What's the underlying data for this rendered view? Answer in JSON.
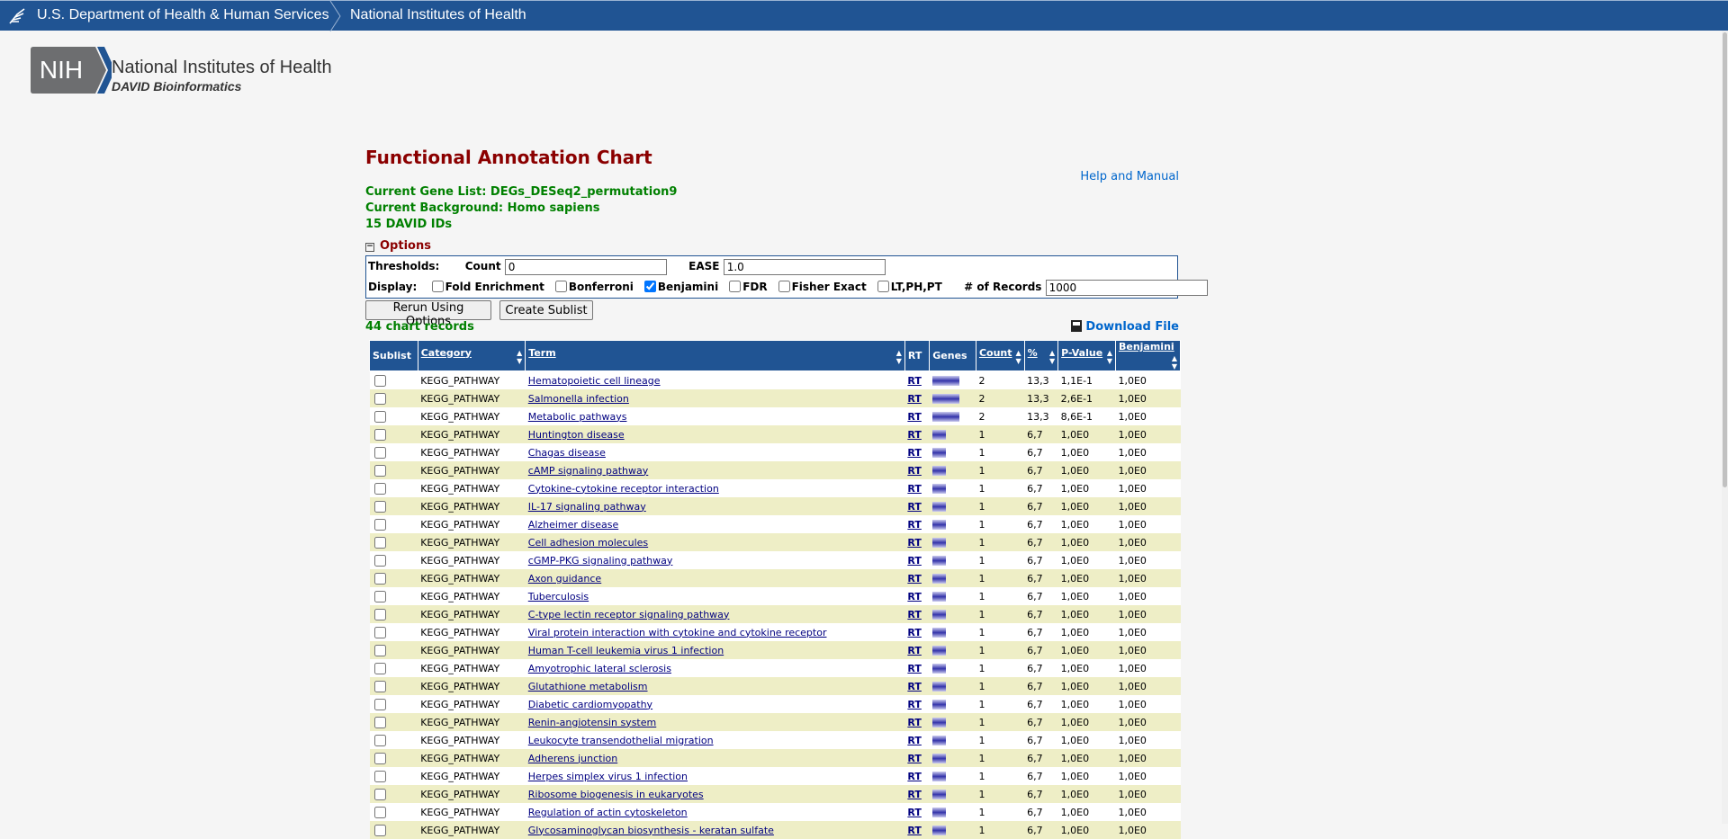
{
  "hhs": {
    "department": "U.S. Department of Health & Human Services",
    "institute": "National Institutes of Health"
  },
  "logo": {
    "badge": "NIH",
    "title": "National Institutes of Health",
    "subtitle": "DAVID Bioinformatics"
  },
  "page": {
    "title": "Functional Annotation Chart",
    "help": "Help and Manual",
    "gene_list": "Current Gene List: DEGs_DESeq2_permutation9",
    "background": "Current Background: Homo sapiens",
    "ids": "15 DAVID IDs"
  },
  "options": {
    "toggle_label": "Options",
    "thresholds_label": "Thresholds:",
    "count_label": "Count",
    "count_value": "0",
    "ease_label": "EASE",
    "ease_value": "1.0",
    "display_label": "Display:",
    "checkboxes": [
      {
        "label": "Fold Enrichment",
        "checked": false
      },
      {
        "label": "Bonferroni",
        "checked": false
      },
      {
        "label": "Benjamini",
        "checked": true
      },
      {
        "label": "FDR",
        "checked": false
      },
      {
        "label": "Fisher Exact",
        "checked": false
      },
      {
        "label": "LT,PH,PT",
        "checked": false
      }
    ],
    "records_label": "# of Records",
    "records_value": "1000"
  },
  "buttons": {
    "rerun": "Rerun Using Options",
    "sublist": "Create Sublist"
  },
  "record_count": "44 chart records",
  "download": "Download File",
  "table": {
    "headers": [
      "Sublist",
      "Category",
      "Term",
      "RT",
      "Genes",
      "Count",
      "%",
      "P-Value",
      "Benjamini"
    ],
    "rows": [
      {
        "category": "KEGG_PATHWAY",
        "term": "Hematopoietic cell lineage",
        "rt": "RT",
        "count": "2",
        "pct": "13,3",
        "p": "1,1E-1",
        "b": "1,0E0"
      },
      {
        "category": "KEGG_PATHWAY",
        "term": "Salmonella infection",
        "rt": "RT",
        "count": "2",
        "pct": "13,3",
        "p": "2,6E-1",
        "b": "1,0E0"
      },
      {
        "category": "KEGG_PATHWAY",
        "term": "Metabolic pathways",
        "rt": "RT",
        "count": "2",
        "pct": "13,3",
        "p": "8,6E-1",
        "b": "1,0E0"
      },
      {
        "category": "KEGG_PATHWAY",
        "term": "Huntington disease",
        "rt": "RT",
        "count": "1",
        "pct": "6,7",
        "p": "1,0E0",
        "b": "1,0E0"
      },
      {
        "category": "KEGG_PATHWAY",
        "term": "Chagas disease",
        "rt": "RT",
        "count": "1",
        "pct": "6,7",
        "p": "1,0E0",
        "b": "1,0E0"
      },
      {
        "category": "KEGG_PATHWAY",
        "term": "cAMP signaling pathway",
        "rt": "RT",
        "count": "1",
        "pct": "6,7",
        "p": "1,0E0",
        "b": "1,0E0"
      },
      {
        "category": "KEGG_PATHWAY",
        "term": "Cytokine-cytokine receptor interaction",
        "rt": "RT",
        "count": "1",
        "pct": "6,7",
        "p": "1,0E0",
        "b": "1,0E0"
      },
      {
        "category": "KEGG_PATHWAY",
        "term": "IL-17 signaling pathway",
        "rt": "RT",
        "count": "1",
        "pct": "6,7",
        "p": "1,0E0",
        "b": "1,0E0"
      },
      {
        "category": "KEGG_PATHWAY",
        "term": "Alzheimer disease",
        "rt": "RT",
        "count": "1",
        "pct": "6,7",
        "p": "1,0E0",
        "b": "1,0E0"
      },
      {
        "category": "KEGG_PATHWAY",
        "term": "Cell adhesion molecules",
        "rt": "RT",
        "count": "1",
        "pct": "6,7",
        "p": "1,0E0",
        "b": "1,0E0"
      },
      {
        "category": "KEGG_PATHWAY",
        "term": "cGMP-PKG signaling pathway",
        "rt": "RT",
        "count": "1",
        "pct": "6,7",
        "p": "1,0E0",
        "b": "1,0E0"
      },
      {
        "category": "KEGG_PATHWAY",
        "term": "Axon guidance",
        "rt": "RT",
        "count": "1",
        "pct": "6,7",
        "p": "1,0E0",
        "b": "1,0E0"
      },
      {
        "category": "KEGG_PATHWAY",
        "term": "Tuberculosis",
        "rt": "RT",
        "count": "1",
        "pct": "6,7",
        "p": "1,0E0",
        "b": "1,0E0"
      },
      {
        "category": "KEGG_PATHWAY",
        "term": "C-type lectin receptor signaling pathway",
        "rt": "RT",
        "count": "1",
        "pct": "6,7",
        "p": "1,0E0",
        "b": "1,0E0"
      },
      {
        "category": "KEGG_PATHWAY",
        "term": "Viral protein interaction with cytokine and cytokine receptor",
        "rt": "RT",
        "count": "1",
        "pct": "6,7",
        "p": "1,0E0",
        "b": "1,0E0"
      },
      {
        "category": "KEGG_PATHWAY",
        "term": "Human T-cell leukemia virus 1 infection",
        "rt": "RT",
        "count": "1",
        "pct": "6,7",
        "p": "1,0E0",
        "b": "1,0E0"
      },
      {
        "category": "KEGG_PATHWAY",
        "term": "Amyotrophic lateral sclerosis",
        "rt": "RT",
        "count": "1",
        "pct": "6,7",
        "p": "1,0E0",
        "b": "1,0E0"
      },
      {
        "category": "KEGG_PATHWAY",
        "term": "Glutathione metabolism",
        "rt": "RT",
        "count": "1",
        "pct": "6,7",
        "p": "1,0E0",
        "b": "1,0E0"
      },
      {
        "category": "KEGG_PATHWAY",
        "term": "Diabetic cardiomyopathy",
        "rt": "RT",
        "count": "1",
        "pct": "6,7",
        "p": "1,0E0",
        "b": "1,0E0"
      },
      {
        "category": "KEGG_PATHWAY",
        "term": "Renin-angiotensin system",
        "rt": "RT",
        "count": "1",
        "pct": "6,7",
        "p": "1,0E0",
        "b": "1,0E0"
      },
      {
        "category": "KEGG_PATHWAY",
        "term": "Leukocyte transendothelial migration",
        "rt": "RT",
        "count": "1",
        "pct": "6,7",
        "p": "1,0E0",
        "b": "1,0E0"
      },
      {
        "category": "KEGG_PATHWAY",
        "term": "Adherens junction",
        "rt": "RT",
        "count": "1",
        "pct": "6,7",
        "p": "1,0E0",
        "b": "1,0E0"
      },
      {
        "category": "KEGG_PATHWAY",
        "term": "Herpes simplex virus 1 infection",
        "rt": "RT",
        "count": "1",
        "pct": "6,7",
        "p": "1,0E0",
        "b": "1,0E0"
      },
      {
        "category": "KEGG_PATHWAY",
        "term": "Ribosome biogenesis in eukaryotes",
        "rt": "RT",
        "count": "1",
        "pct": "6,7",
        "p": "1,0E0",
        "b": "1,0E0"
      },
      {
        "category": "KEGG_PATHWAY",
        "term": "Regulation of actin cytoskeleton",
        "rt": "RT",
        "count": "1",
        "pct": "6,7",
        "p": "1,0E0",
        "b": "1,0E0"
      },
      {
        "category": "KEGG_PATHWAY",
        "term": "Glycosaminoglycan biosynthesis - keratan sulfate",
        "rt": "RT",
        "count": "1",
        "pct": "6,7",
        "p": "1,0E0",
        "b": "1,0E0"
      }
    ]
  },
  "colors": {
    "header_blue": "#205493",
    "title_red": "#8b0000",
    "info_green": "#008000",
    "row_alt": "#eeeec6"
  }
}
